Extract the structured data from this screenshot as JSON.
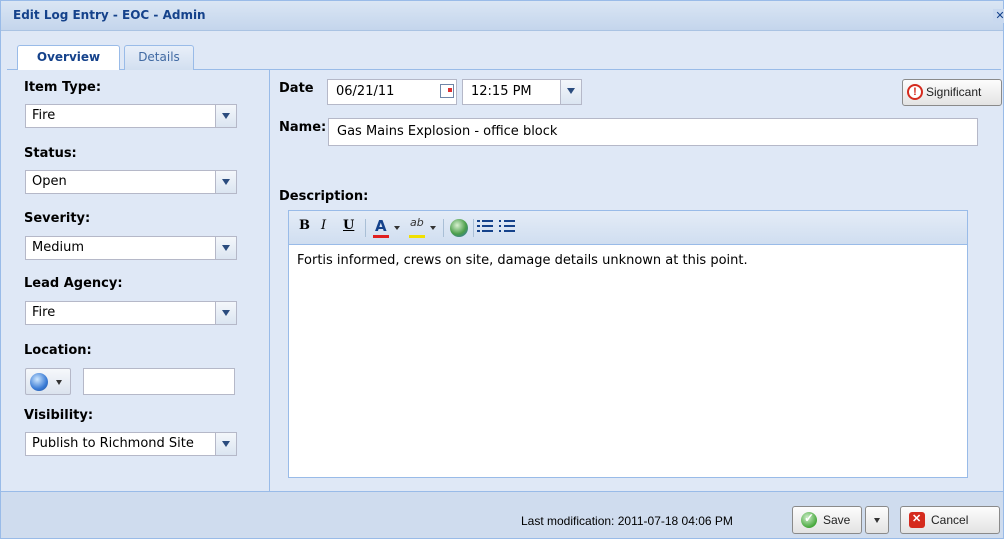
{
  "window": {
    "title": "Edit Log Entry - EOC - Admin",
    "close_icon": "close-icon"
  },
  "tabs": [
    {
      "label": "Overview",
      "active": true
    },
    {
      "label": "Details",
      "active": false
    }
  ],
  "left": {
    "item_type": {
      "label": "Item Type:",
      "value": "Fire"
    },
    "status": {
      "label": "Status:",
      "value": "Open"
    },
    "severity": {
      "label": "Severity:",
      "value": "Medium"
    },
    "lead_agency": {
      "label": "Lead Agency:",
      "value": "Fire"
    },
    "location": {
      "label": "Location:",
      "value": ""
    },
    "visibility": {
      "label": "Visibility:",
      "value": "Publish to Richmond Site"
    }
  },
  "right": {
    "date_label": "Date",
    "date_value": "06/21/11",
    "time_value": "12:15 PM",
    "significant_label": "Significant",
    "name_label": "Name:",
    "name_value": "Gas Mains Explosion - office block",
    "description_label": "Description:",
    "toolbar": {
      "bold": "B",
      "italic": "I",
      "underline": "U",
      "font_color": "A",
      "highlight": "ab"
    },
    "description_text": "Fortis informed, crews on site, damage details unknown at this point."
  },
  "footer": {
    "last_modification": "Last modification: 2011-07-18 04:06 PM",
    "save_label": "Save",
    "cancel_label": "Cancel"
  },
  "colors": {
    "accent": "#15428b",
    "panel": "#dfe8f6",
    "border": "#99bbe8"
  }
}
